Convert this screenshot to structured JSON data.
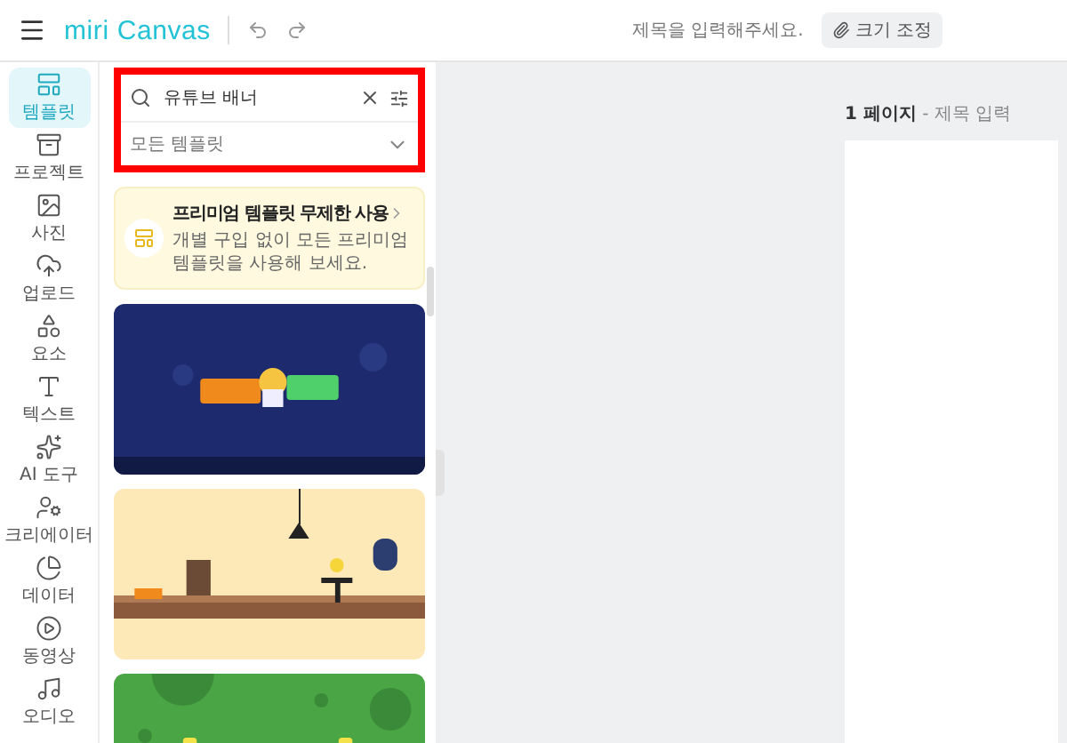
{
  "topbar": {
    "logo": "miri Canvas",
    "title_placeholder": "제목을 입력해주세요.",
    "resize_button": "크기 조정"
  },
  "sidebar": {
    "items": [
      {
        "label": "템플릿",
        "selected": true
      },
      {
        "label": "프로젝트",
        "selected": false
      },
      {
        "label": "사진",
        "selected": false
      },
      {
        "label": "업로드",
        "selected": false
      },
      {
        "label": "요소",
        "selected": false
      },
      {
        "label": "텍스트",
        "selected": false
      },
      {
        "label": "AI 도구",
        "selected": false
      },
      {
        "label": "크리에이터",
        "selected": false
      },
      {
        "label": "데이터",
        "selected": false
      },
      {
        "label": "동영상",
        "selected": false
      },
      {
        "label": "오디오",
        "selected": false
      }
    ]
  },
  "panel": {
    "search": {
      "value": "유튜브 배너"
    },
    "filter": {
      "value": "모든 템플릿"
    },
    "promo": {
      "title": "프리미엄 템플릿 무제한 사용",
      "body": "개별 구입 없이 모든 프리미엄 템플릿을 사용해 보세요."
    }
  },
  "canvas": {
    "page_label": "**1 페이지** - 제목 입력"
  }
}
